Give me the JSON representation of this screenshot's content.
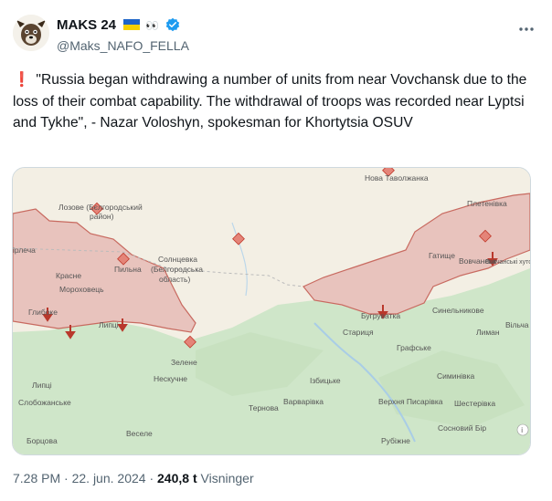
{
  "author": {
    "display_name": "MAKS 24",
    "flag_icon": "ukraine-flag-icon",
    "eyes": "👀",
    "handle": "@Maks_NAFO_FELLA"
  },
  "tweet": {
    "exclamation": "❗",
    "text": "\"Russia began withdrawing a number of units from near Vovchansk due to the loss of their combat capability. The withdrawal of troops was recorded near Lyptsi and Tykhe\", - Nazar Voloshyn, spokesman for Khortytsia OSUV"
  },
  "map": {
    "colors": {
      "occupied": "#e8c3bd",
      "border": "#c86a60",
      "terrain_green": "#cfe6c9",
      "base": "#f3efe4"
    },
    "places": {
      "lozove": "Лозове (Бєлгородський",
      "lozove2": "район)",
      "nova_tavolzhanka": "Нова Таволжанка",
      "pletenivka": "Плетенівка",
      "hlybochok": "ірлеча",
      "kraske": "Красне",
      "pylna": "Пильна",
      "moroz": "Мороховець",
      "solntseva": "Солнцевка",
      "solntseva2": "(Белгородська",
      "solntseva3": "область)",
      "hlyboke": "Глибоке",
      "lyptsi": "Липці",
      "zelene": "Зелене",
      "neskuchne": "Нескучне",
      "lyptsi2": "Липці",
      "slobozhanske": "Слобожанське",
      "bortsova": "Борцова",
      "veselе": "Веселе",
      "ternova": "Тернова",
      "varvarivka": "Варварівка",
      "izbytske": "Ізбицьке",
      "hatyshche": "Гатище",
      "vovchansk": "Вовчанськ",
      "vovchanski": "Вовчанські",
      "buhruvatka": "Бугруватка",
      "staritsa": "Стариця",
      "synelnykove": "Синельникове",
      "lyman": "Лиман",
      "vilcha": "Вільча",
      "hrafske": "Графське",
      "symynivka": "Симинівка",
      "verkhnia": "Верхня Писарівка",
      "shestakove": "Шестерівка",
      "sosnovyi_bir": "Сосновий Бір",
      "rubizhne": "Рубіжне",
      "vovchanski_khutory": "Вовчанські хутори"
    }
  },
  "meta": {
    "time": "7.28 PM",
    "date": "22. jun. 2024",
    "views_count": "240,8 t",
    "views_label": "Visninger",
    "sep": "·"
  }
}
